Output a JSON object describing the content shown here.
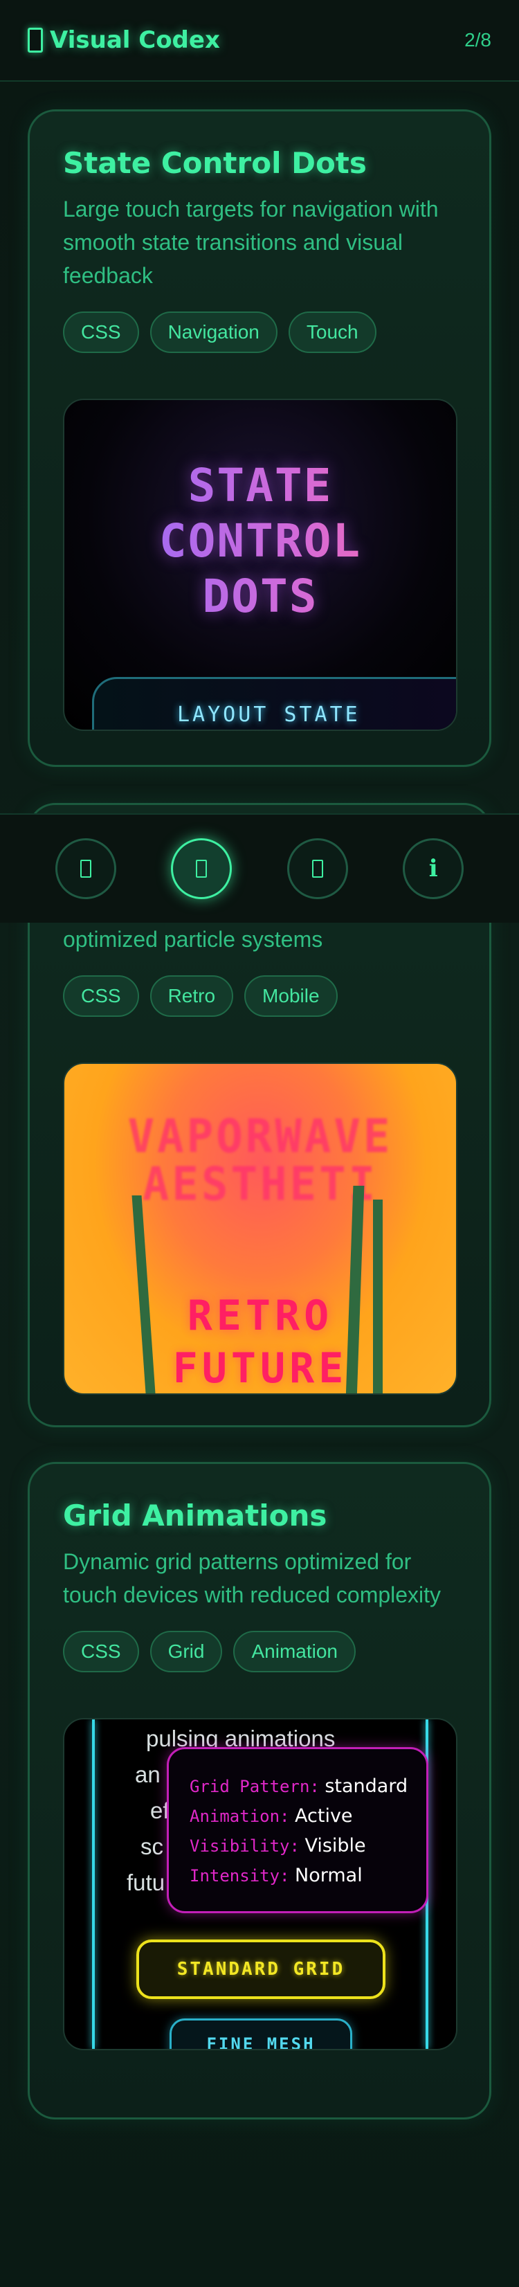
{
  "header": {
    "title": "Visual Codex",
    "counter": "2/8"
  },
  "cards": [
    {
      "title": "State Control Dots",
      "description": "Large touch targets for navigation with smooth state transitions and visual feedback",
      "tags": [
        "CSS",
        "Navigation",
        "Touch"
      ],
      "preview": {
        "headline": [
          "STATE",
          "CONTROL",
          "DOTS"
        ],
        "panel_text": "LAYOUT STATE"
      }
    },
    {
      "description_visible": "optimized particle systems",
      "tags": [
        "CSS",
        "Retro",
        "Mobile"
      ],
      "preview": {
        "blurred_headline": "VAPORWAVE\nAESTHETI",
        "headline": [
          "RETRO",
          "FUTURE"
        ]
      }
    },
    {
      "title": "Grid Animations",
      "description": "Dynamic grid patterns optimized for touch devices with reduced complexity",
      "tags": [
        "CSS",
        "Grid",
        "Animation"
      ],
      "preview": {
        "background_lines": [
          "pulsing animations",
          "an",
          "ef",
          "sc",
          "futu"
        ],
        "info": {
          "pattern_key": "Grid Pattern:",
          "pattern_val": "standard",
          "animation_key": "Animation:",
          "animation_val": "Active",
          "visibility_key": "Visibility:",
          "visibility_val": "Visible",
          "intensity_key": "Intensity:",
          "intensity_val": "Normal"
        },
        "primary_button": "STANDARD GRID",
        "secondary_button": "FINE MESH"
      }
    }
  ],
  "nav": {
    "items": [
      {
        "icon": "square-icon",
        "active": false
      },
      {
        "icon": "square-icon",
        "active": true
      },
      {
        "icon": "square-icon",
        "active": false
      },
      {
        "icon": "info-icon",
        "glyph": "ℹ",
        "active": false
      }
    ]
  },
  "colors": {
    "accent": "#3ef0a2",
    "background": "#0d1f18",
    "magenta": "#e028c8",
    "yellow": "#ede21c",
    "cyan": "#37d9e8"
  }
}
